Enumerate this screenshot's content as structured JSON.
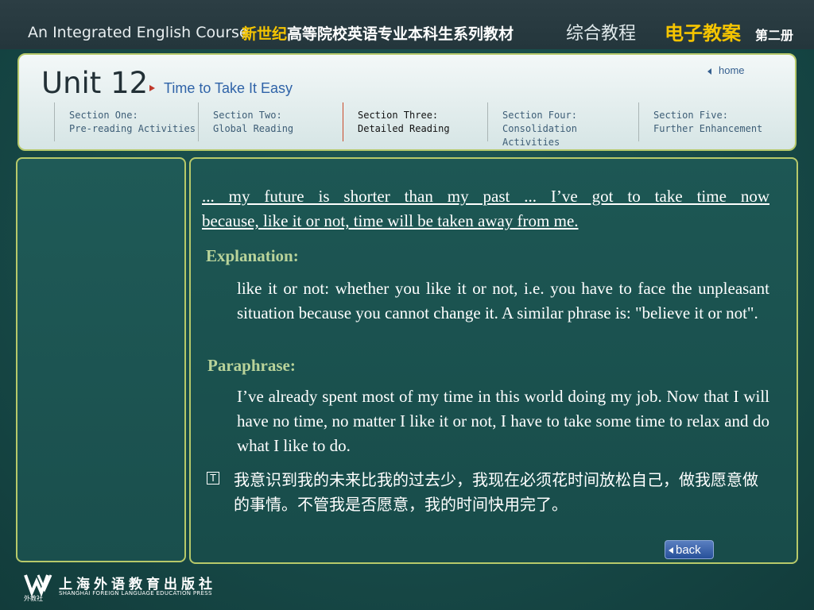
{
  "header": {
    "course_en": "An Integrated English Course",
    "course_cn_highlight": "新世纪",
    "course_cn_rest": "高等院校英语专业本科生系列教材",
    "zonghe": "综合教程",
    "dianzi": "电子教案",
    "volume": "第二册"
  },
  "unit": {
    "title": "Unit 12",
    "subtitle": "Time to Take It Easy",
    "home_label": "home"
  },
  "sections": [
    {
      "line1": "Section One:",
      "line2": "Pre-reading Activities"
    },
    {
      "line1": "Section Two:",
      "line2": "Global Reading"
    },
    {
      "line1": "Section Three:",
      "line2": "Detailed Reading"
    },
    {
      "line1": "Section Four:",
      "line2": "Consolidation Activities"
    },
    {
      "line1": "Section Five:",
      "line2": "Further Enhancement"
    }
  ],
  "active_section": "Section Three:",
  "content": {
    "quote_line1": "... my future is shorter than my past ... I’ve got to take time now",
    "quote_line2": "because, like it or not, time will be taken away from me.",
    "explanation_heading": "Explanation:",
    "explanation_text": "like it or not: whether you like it or not, i.e. you have to face the unpleasant situation because you cannot change it. A similar phrase is: \"believe it or not\".",
    "paraphrase_heading": "Paraphrase:",
    "paraphrase_text": "I’ve already spent most of my time in this world doing my job. Now that I will have no time, no matter I like it or not, I have to take some time to relax and do what I like to do.",
    "translation_icon": "T",
    "translation_text": "我意识到我的未来比我的过去少，我现在必须花时间放松自己，做我愿意做的事情。不管我是否愿意，我的时间快用完了。"
  },
  "nav": {
    "back_label": "back"
  },
  "publisher": {
    "name_cn": "上海外语教育出版社",
    "name_en": "SHANGHAI FOREIGN LANGUAGE EDUCATION PRESS",
    "small_cn": "外教社"
  },
  "colors": {
    "accent_yellow": "#f5c400",
    "heading_green": "#b9d39a",
    "panel_border": "#b7c96a",
    "link_blue": "#2f63a8"
  }
}
